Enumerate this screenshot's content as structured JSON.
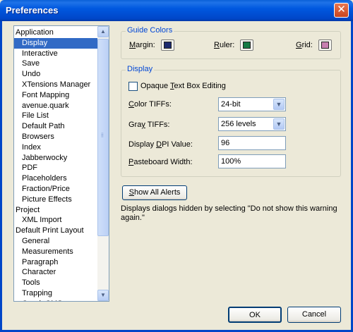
{
  "window": {
    "title": "Preferences"
  },
  "categories": [
    {
      "label": "Application",
      "level": 0
    },
    {
      "label": "Display",
      "level": 1,
      "selected": true
    },
    {
      "label": "Interactive",
      "level": 1
    },
    {
      "label": "Save",
      "level": 1
    },
    {
      "label": "Undo",
      "level": 1
    },
    {
      "label": "XTensions Manager",
      "level": 1
    },
    {
      "label": "Font Mapping",
      "level": 1
    },
    {
      "label": "avenue.quark",
      "level": 1
    },
    {
      "label": "File List",
      "level": 1
    },
    {
      "label": "Default Path",
      "level": 1
    },
    {
      "label": "Browsers",
      "level": 1
    },
    {
      "label": "Index",
      "level": 1
    },
    {
      "label": "Jabberwocky",
      "level": 1
    },
    {
      "label": "PDF",
      "level": 1
    },
    {
      "label": "Placeholders",
      "level": 1
    },
    {
      "label": "Fraction/Price",
      "level": 1
    },
    {
      "label": "Picture Effects",
      "level": 1
    },
    {
      "label": "Project",
      "level": 0
    },
    {
      "label": "XML Import",
      "level": 1
    },
    {
      "label": "Default Print Layout",
      "level": 0
    },
    {
      "label": "General",
      "level": 1
    },
    {
      "label": "Measurements",
      "level": 1
    },
    {
      "label": "Paragraph",
      "level": 1
    },
    {
      "label": "Character",
      "level": 1
    },
    {
      "label": "Tools",
      "level": 1
    },
    {
      "label": "Trapping",
      "level": 1
    },
    {
      "label": "Quark CMS",
      "level": 1
    }
  ],
  "guide_colors": {
    "legend": "Guide Colors",
    "margin_label": "Margin:",
    "margin_color": "#1c2a6e",
    "ruler_label": "Ruler:",
    "ruler_color": "#157a45",
    "grid_label": "Grid:",
    "grid_color": "#c77fb0"
  },
  "display": {
    "legend": "Display",
    "opaque_label": "Opaque Text Box Editing",
    "opaque_checked": false,
    "color_tiffs_label": "Color TIFFs:",
    "color_tiffs_value": "24-bit",
    "gray_tiffs_label": "Gray TIFFs:",
    "gray_tiffs_value": "256 levels",
    "dpi_label": "Display DPI Value:",
    "dpi_value": "96",
    "pasteboard_label": "Pasteboard Width:",
    "pasteboard_value": "100%"
  },
  "alerts": {
    "button_label": "Show All Alerts",
    "description": "Displays dialogs hidden by selecting \"Do not show this warning again.\""
  },
  "footer": {
    "ok_label": "OK",
    "cancel_label": "Cancel"
  }
}
